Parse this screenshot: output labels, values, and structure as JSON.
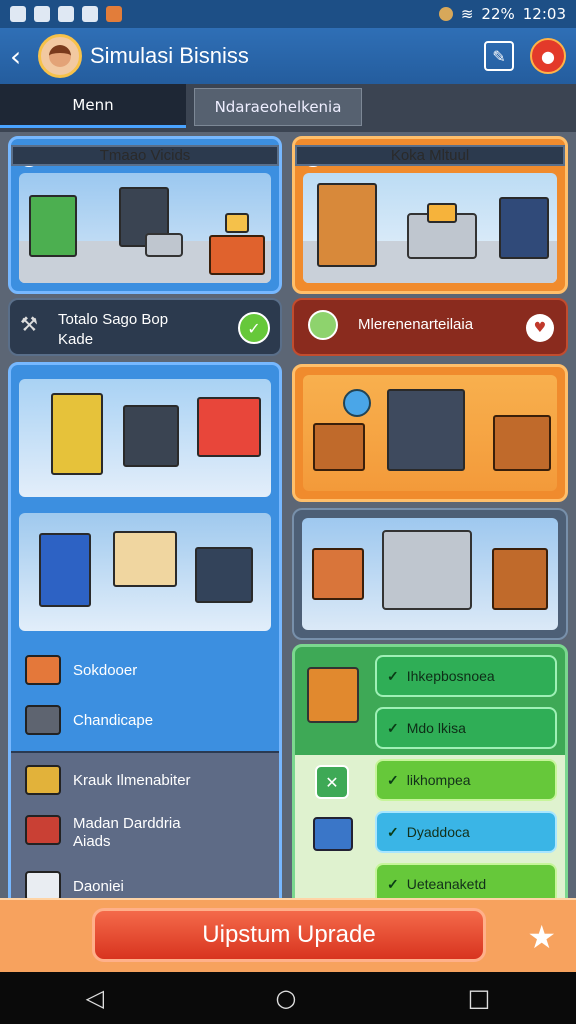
{
  "status": {
    "battery": "22%",
    "time": "12:03"
  },
  "header": {
    "title": "Simulasi Bisniss",
    "back_icon": "arrow-left-icon",
    "edit_icon": "edit-icon",
    "alert_icon": "alert-icon"
  },
  "tabs": [
    {
      "label": "Menn",
      "active": true
    },
    {
      "label": "Ndaraeohelkenia",
      "active": false
    }
  ],
  "cards": {
    "top_left_title": "Tmaao Vicids",
    "top_right_title": "Koka Mltuul",
    "bar_left": {
      "line1": "Totalo Sago Bop",
      "line2": "Kade"
    },
    "bar_right": {
      "text": "Mlerenenarteilaia"
    }
  },
  "list_left": [
    "Sokdooer",
    "Chandicape",
    "Krauk Ilmenabiter",
    "Madan Darddria",
    "Aiads",
    "Daoniei"
  ],
  "list_right": [
    "Ihkepbosnoea",
    "Mdo lkisa",
    "likhompea",
    "Dyaddoca",
    "Ueteanaketd"
  ],
  "bottom": {
    "upgrade_label": "Uipstum Uprade",
    "star_icon": "star-icon"
  },
  "colors": {
    "header": "#2f6fb6",
    "accent_orange": "#f08b2d",
    "accent_blue": "#3c8fe0",
    "accent_green": "#3ea956",
    "upgrade": "#e0432a"
  }
}
